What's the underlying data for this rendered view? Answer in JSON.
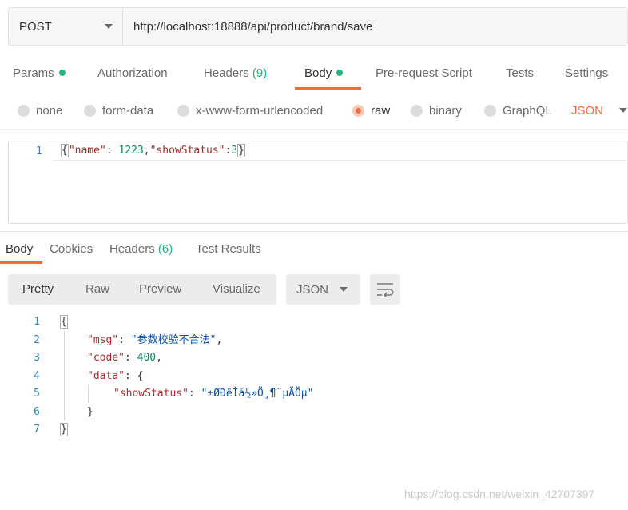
{
  "request": {
    "method": "POST",
    "url": "http://localhost:18888/api/product/brand/save"
  },
  "request_tabs": [
    {
      "label": "Params",
      "indicator": "dot"
    },
    {
      "label": "Authorization"
    },
    {
      "label": "Headers",
      "count": "(9)"
    },
    {
      "label": "Body",
      "indicator": "dot",
      "active": true
    },
    {
      "label": "Pre-request Script"
    },
    {
      "label": "Tests"
    },
    {
      "label": "Settings"
    }
  ],
  "body_types": [
    "none",
    "form-data",
    "x-www-form-urlencoded",
    "raw",
    "binary",
    "GraphQL"
  ],
  "body_type_selected": "raw",
  "body_format": "JSON",
  "request_body": {
    "line_number": "1",
    "open_brace": "{",
    "key1": "\"name\"",
    "colon1": ": ",
    "val1": "1223",
    "comma1": ",",
    "key2": "\"showStatus\"",
    "colon2": ":",
    "val2": "3",
    "close_brace": "}"
  },
  "response_tabs": [
    {
      "label": "Body",
      "active": true
    },
    {
      "label": "Cookies"
    },
    {
      "label": "Headers",
      "count": "(6)"
    },
    {
      "label": "Test Results"
    }
  ],
  "view_modes": [
    "Pretty",
    "Raw",
    "Preview",
    "Visualize"
  ],
  "view_mode_selected": "Pretty",
  "response_format": "JSON",
  "response_body": {
    "line_numbers": [
      "1",
      "2",
      "3",
      "4",
      "5",
      "6",
      "7"
    ],
    "open_brace": "{",
    "msg_key": "\"msg\"",
    "msg_val": "\"参数校验不合法\"",
    "code_key": "\"code\"",
    "code_val": "400",
    "data_key": "\"data\"",
    "data_open": "{",
    "show_key": "\"showStatus\"",
    "show_val": "\"±ØÐëÌá½»Ö¸¶¨µÄÖµ\"",
    "data_close": "}",
    "close_brace": "}",
    "colon": ": ",
    "comma": ","
  },
  "watermark": "https://blog.csdn.net/weixin_42707397",
  "colors": {
    "accent": "#f26b3a",
    "success": "#26b47f",
    "key": "#a52a2a",
    "number": "#098658",
    "string": "#0451a5"
  },
  "icons": [
    "chevron-down-icon",
    "wrap-lines-icon"
  ]
}
